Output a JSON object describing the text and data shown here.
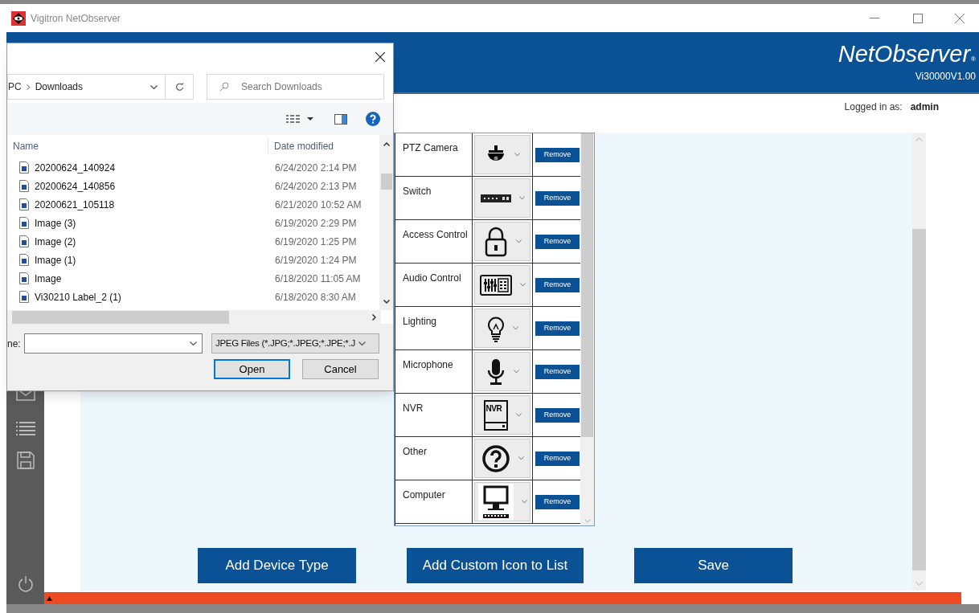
{
  "window": {
    "title": "Vigitron NetObserver"
  },
  "header": {
    "brand": "NetObserver",
    "trademark": "®",
    "version": "Vi30000V1.00"
  },
  "user": {
    "label": "Logged in as:",
    "name": "admin"
  },
  "device_types": [
    {
      "name": "PTZ Camera",
      "kind": "ptz",
      "action": "Remove"
    },
    {
      "name": "Switch",
      "kind": "switch",
      "action": "Remove"
    },
    {
      "name": "Access Control",
      "kind": "lock",
      "action": "Remove"
    },
    {
      "name": "Audio Control",
      "kind": "audio",
      "action": "Remove"
    },
    {
      "name": "Lighting",
      "kind": "bulb",
      "action": "Remove"
    },
    {
      "name": "Microphone",
      "kind": "mic",
      "action": "Remove"
    },
    {
      "name": "NVR",
      "kind": "nvr",
      "icon_text": "NVR",
      "action": "Remove"
    },
    {
      "name": "Other",
      "kind": "question",
      "action": "Remove"
    },
    {
      "name": "Computer",
      "kind": "computer",
      "action": "Remove"
    }
  ],
  "buttons": [
    "Add Device Type",
    "Add Custom Icon to List",
    "Save"
  ],
  "dialog": {
    "breadcrumb": [
      "PC",
      "Downloads"
    ],
    "search": {
      "placeholder": "Search Downloads"
    },
    "columns": [
      "Name",
      "Date modified"
    ],
    "files": [
      {
        "name": "20200624_140924",
        "date": "6/24/2020 2:14 PM"
      },
      {
        "name": "20200624_140856",
        "date": "6/24/2020 2:13 PM"
      },
      {
        "name": "20200621_105118",
        "date": "6/21/2020 10:52 AM"
      },
      {
        "name": "Image (3)",
        "date": "6/19/2020 2:29 PM"
      },
      {
        "name": "Image (2)",
        "date": "6/19/2020 1:25 PM"
      },
      {
        "name": "Image (1)",
        "date": "6/19/2020 1:24 PM"
      },
      {
        "name": "Image",
        "date": "6/18/2020 11:05 AM"
      },
      {
        "name": "Vi30210 Label_2 (1)",
        "date": "6/18/2020 8:30 AM"
      }
    ],
    "file_name_label": "ne:",
    "filter": "JPEG Files (*.JPG;*.JPEG;*.JPE;*.J",
    "buttons": [
      {
        "label": "Open",
        "default": true
      },
      {
        "label": "Cancel",
        "default": false
      }
    ]
  }
}
